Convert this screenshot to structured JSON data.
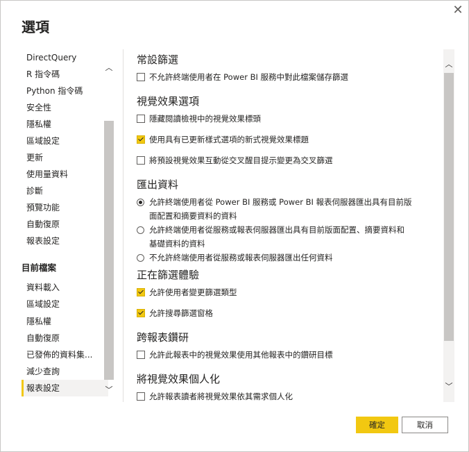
{
  "dialog": {
    "title": "選項",
    "close_glyph": "✕"
  },
  "nav": {
    "global_items": [
      "DirectQuery",
      "R 指令碼",
      "Python 指令碼",
      "安全性",
      "隱私權",
      "區域設定",
      "更新",
      "使用量資料",
      "診斷",
      "預覽功能",
      "自動復原",
      "報表設定"
    ],
    "current_file_header": "目前檔案",
    "file_items": [
      "資料載入",
      "區域設定",
      "隱私權",
      "自動復原",
      "已發佈的資料集...",
      "減少查詢",
      "報表設定"
    ],
    "selected": "報表設定"
  },
  "sections": {
    "persistent_filters": {
      "title": "常設篩選",
      "options": [
        {
          "label": "不允許終端使用者在 Power BI 服務中對此檔案儲存篩選",
          "checked": false
        }
      ]
    },
    "visual_options": {
      "title": "視覺效果選項",
      "options": [
        {
          "label": "隱藏閱讀檢視中的視覺效果標頭",
          "checked": false
        },
        {
          "label": "使用具有已更新樣式選項的新式視覺效果標題",
          "checked": true
        },
        {
          "label": "將預設視覺效果互動從交叉醒目提示變更為交叉篩選",
          "checked": false
        }
      ]
    },
    "export_data": {
      "title": "匯出資料",
      "options": [
        {
          "line1": "允許終端使用者從 Power BI 服務或 Power BI 報表伺服器匯出具有目前版",
          "line2": "面配置和摘要資料的資料",
          "selected": true
        },
        {
          "line1": "允許終端使用者從服務或報表伺服器匯出具有目前版面配置、摘要資料和",
          "line2": "基礎資料的資料",
          "selected": false
        },
        {
          "line1": "不允許終端使用者從服務或報表伺服器匯出任何資料",
          "line2": "",
          "selected": false
        }
      ]
    },
    "filtering_experience": {
      "title": "正在篩選體驗",
      "options": [
        {
          "label": "允許使用者變更篩選類型",
          "checked": true
        },
        {
          "label": "允許搜尋篩選窗格",
          "checked": true
        }
      ]
    },
    "cross_report_drillthrough": {
      "title": "跨報表鑽研",
      "options": [
        {
          "label": "允許此報表中的視覺效果使用其他報表中的鑽研目標",
          "checked": false
        }
      ]
    },
    "personalize_visuals": {
      "title": "將視覺效果個人化",
      "options": [
        {
          "label": "允許報表讀者將視覺效果依其需求個人化",
          "checked": false
        }
      ]
    }
  },
  "buttons": {
    "ok": "確定",
    "cancel": "取消"
  },
  "scroll": {
    "up_glyph": "︿",
    "down_glyph": "﹀"
  },
  "colors": {
    "accent": "#f2c811",
    "selected_bg": "#f3f2f1",
    "scrollbar": "#c8c6c4"
  }
}
